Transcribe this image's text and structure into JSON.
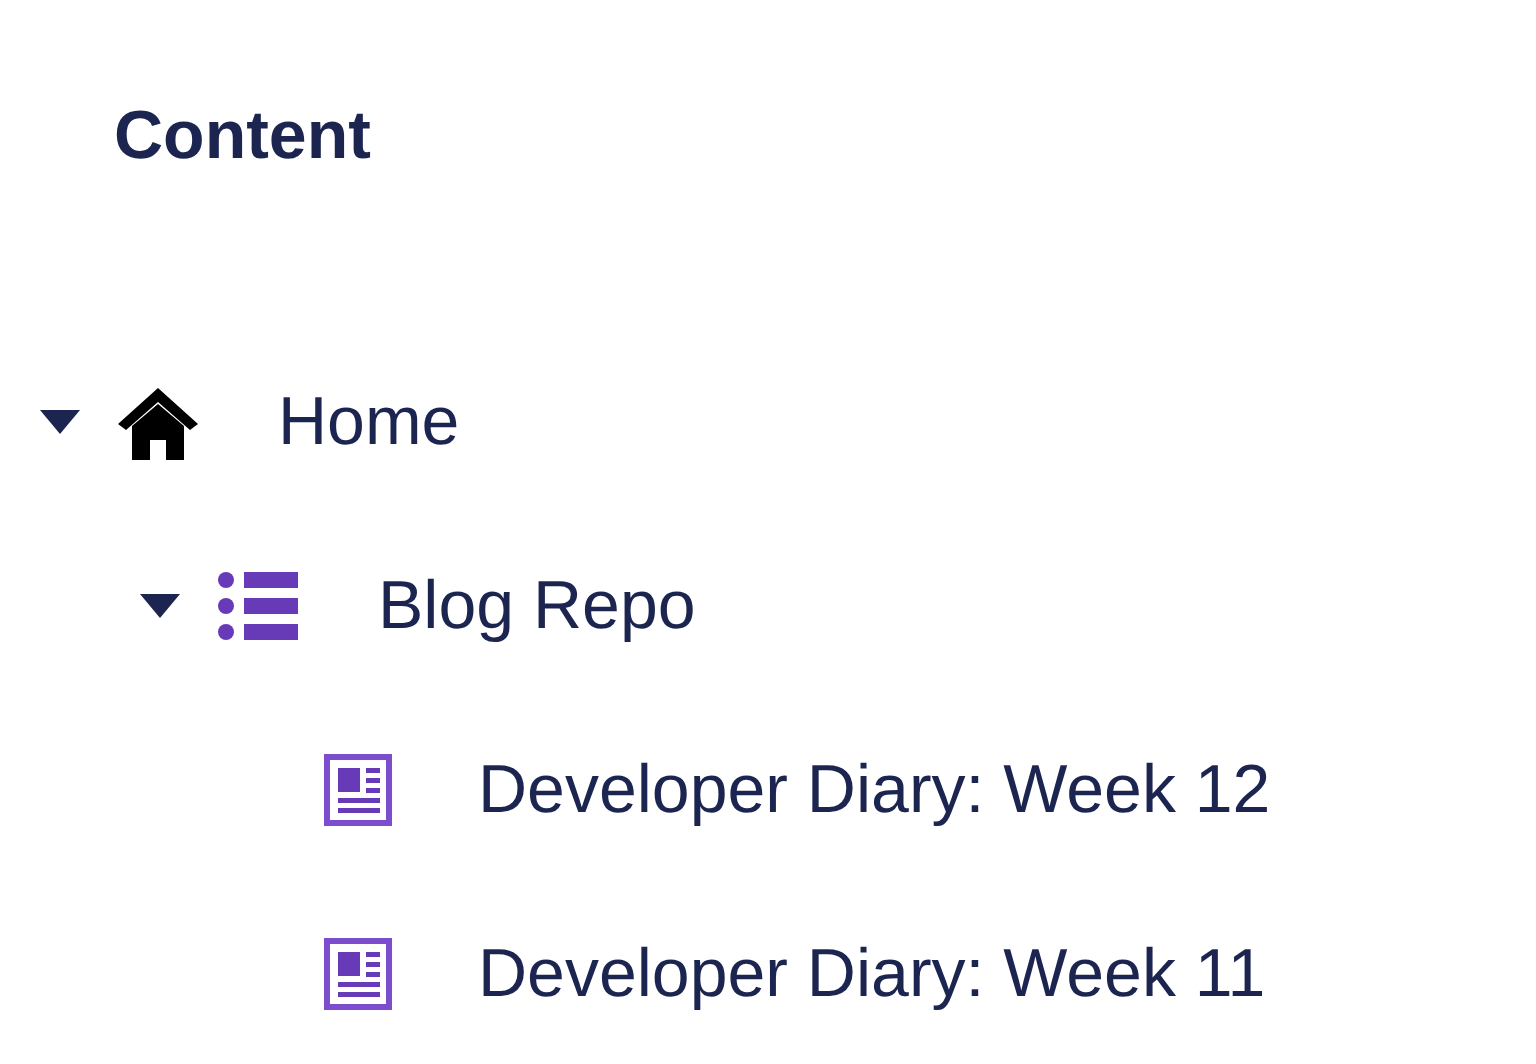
{
  "heading": "Content",
  "tree": [
    {
      "label": "Home",
      "kind": "home",
      "expanded": true,
      "children": [
        {
          "label": "Blog Repo",
          "kind": "list",
          "expanded": true,
          "children": [
            {
              "label": "Developer Diary: Week 12",
              "kind": "page"
            },
            {
              "label": "Developer Diary: Week 11",
              "kind": "page"
            }
          ]
        }
      ]
    }
  ]
}
